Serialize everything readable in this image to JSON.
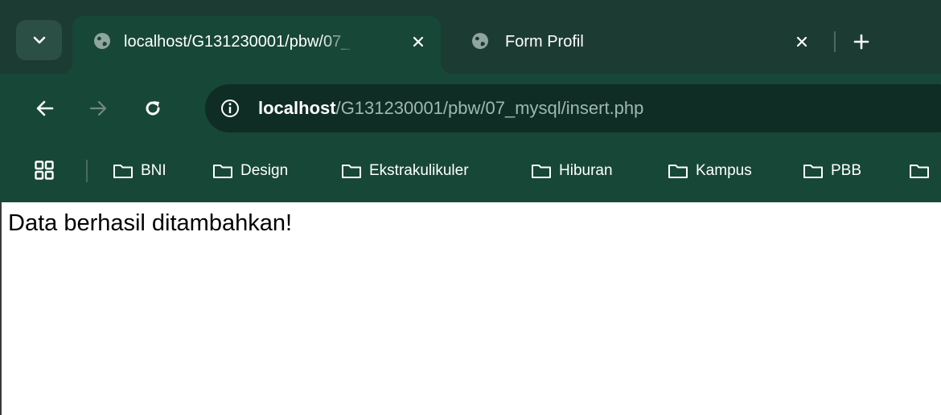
{
  "browser": {
    "tabs": [
      {
        "title": "localhost/G131230001/pbw/07_",
        "active": true
      },
      {
        "title": "Form Profil",
        "active": false
      }
    ],
    "address_bar": {
      "host": "localhost",
      "path": "/G131230001/pbw/07_mysql/insert.php"
    },
    "bookmarks": [
      {
        "label": "BNI"
      },
      {
        "label": "Design"
      },
      {
        "label": "Ekstrakulikuler"
      },
      {
        "label": "Hiburan"
      },
      {
        "label": "Kampus"
      },
      {
        "label": "PBB"
      },
      {
        "label": ""
      }
    ]
  },
  "page": {
    "message": "Data berhasil ditambahkan!"
  },
  "colors": {
    "tabstrip": "#1c3b33",
    "toolbar": "#174737",
    "omnibox": "#0f2d24",
    "url_path": "#9fb8ae"
  },
  "icons": {
    "tab_search": "chevron-down-icon",
    "favicon": "globe-icon",
    "close": "close-icon",
    "new_tab": "plus-icon",
    "back": "arrow-left-icon",
    "forward": "arrow-right-icon",
    "reload": "reload-icon",
    "site_info": "info-icon",
    "apps": "apps-grid-icon",
    "folder": "folder-icon"
  }
}
